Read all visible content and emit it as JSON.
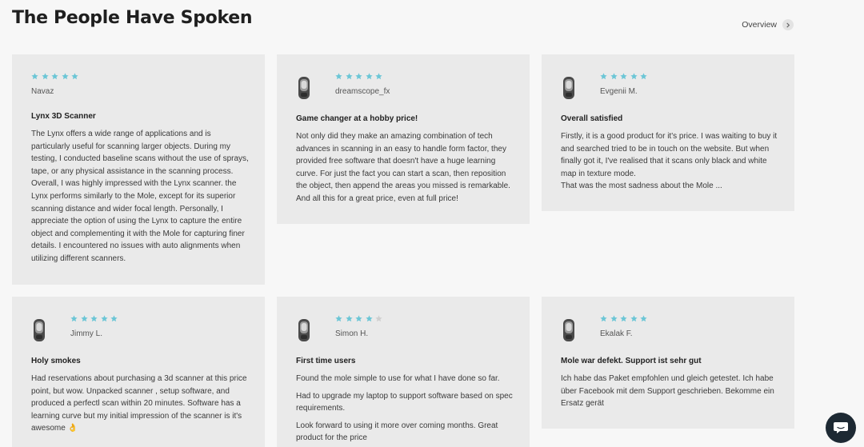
{
  "page": {
    "title": "The People Have Spoken",
    "overview_label": "Overview"
  },
  "colors": {
    "star_filled": "#6cc6d6",
    "star_empty": "#cfcfcf",
    "card_bg": "#eaeaea"
  },
  "reviews": [
    {
      "rating": 5,
      "reviewer": "Navaz",
      "title": "Lynx 3D Scanner",
      "body": [
        "The Lynx offers a wide range of applications and is particularly useful for scanning larger objects. During my testing, I conducted baseline scans without the use of sprays, tape, or any physical assistance in the scanning process. Overall, I was highly impressed with the Lynx scanner. the Lynx performs similarly to the Mole, except for its superior scanning distance and wider focal length. Personally, I appreciate the option of using the Lynx to capture the entire object and complementing it with the Mole for capturing finer details. I encountered no issues with auto alignments when utilizing different scanners."
      ]
    },
    {
      "rating": 5,
      "reviewer": "dreamscope_fx",
      "title": "Game changer at a hobby price!",
      "body": [
        "Not only did they make an amazing combination of tech advances in scanning in an easy to handle form factor, they provided free software that doesn't have a huge learning curve. For just the fact you can start a scan, then reposition the object, then append the areas you missed is remarkable. And all this for a great price, even at full price!"
      ]
    },
    {
      "rating": 5,
      "reviewer": "Evgenii M.",
      "title": "Overall satisfied",
      "body": [
        "Firstly, it is a good product for it's price. I was waiting to buy it and searched tried to be in touch on the website. But when finally got it, I've realised that it scans only black and white map in texture mode.\nThat was the most sadness about the Mole ..."
      ]
    },
    {
      "rating": 5,
      "reviewer": "Jimmy L.",
      "title": "Holy smokes",
      "body": [
        "Had reservations about purchasing a 3d scanner at this price point, but wow. Unpacked scanner , setup software, and produced a perfectl scan within 20 minutes. Software has a learning curve but my initial impression of the scanner is it's awesome 👌"
      ]
    },
    {
      "rating": 4,
      "reviewer": "Simon H.",
      "title": "First time users",
      "body": [
        "Found the mole simple to use for what I have done so far.",
        "Had to upgrade my laptop to support software based on spec requirements.",
        "Look forward to using it more over coming months. Great product for the price"
      ]
    },
    {
      "rating": 5,
      "reviewer": "Ekalak F.",
      "title": "Mole war defekt. Support ist sehr gut",
      "body": [
        "Ich habe das Paket empfohlen und gleich getestet. Ich habe über Facebook mit dem Support geschrieben. Bekomme ein Ersatz gerät"
      ]
    }
  ]
}
